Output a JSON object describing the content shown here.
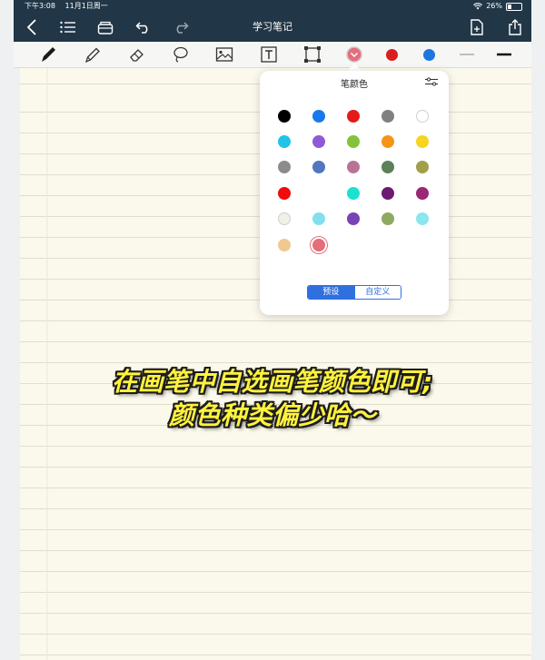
{
  "status": {
    "time": "下午3:08",
    "date": "11月1日周一",
    "battery": "26%"
  },
  "nav": {
    "title": "学习笔记"
  },
  "toolbar": {
    "colors": {
      "red": "#d81e1e",
      "blue": "#1e77e0"
    },
    "tools": [
      "pen",
      "pencil",
      "eraser",
      "lasso",
      "image",
      "text",
      "shape",
      "color-picker"
    ]
  },
  "palette": {
    "title": "笔颜色",
    "rows": [
      [
        "#000000",
        "#1979ea",
        "#e41b1b",
        "#808080",
        "#ffffff"
      ],
      [
        "#22c3e6",
        "#8f5ad8",
        "#83c33a",
        "#f59517",
        "#f6d51c"
      ],
      [
        "#8c8c8c",
        "#5276c0",
        "#b97495",
        "#5b805a",
        "#a1a049"
      ],
      [
        "#f10b0b",
        "",
        "#1be2cf",
        "#6c1a72",
        "#9a2874"
      ],
      [
        "#f0f0e6",
        "#82e0ec",
        "#7842b8",
        "#8ea962",
        "#8be6ee"
      ],
      [
        "#efc98f",
        "#e46e7b"
      ]
    ],
    "selected": "#e46e7b",
    "tabs": {
      "preset": "预设",
      "custom": "自定义"
    }
  },
  "caption": {
    "line1": "在画笔中自选画笔颜色即可;",
    "line2": "颜色种类偏少哈～"
  }
}
